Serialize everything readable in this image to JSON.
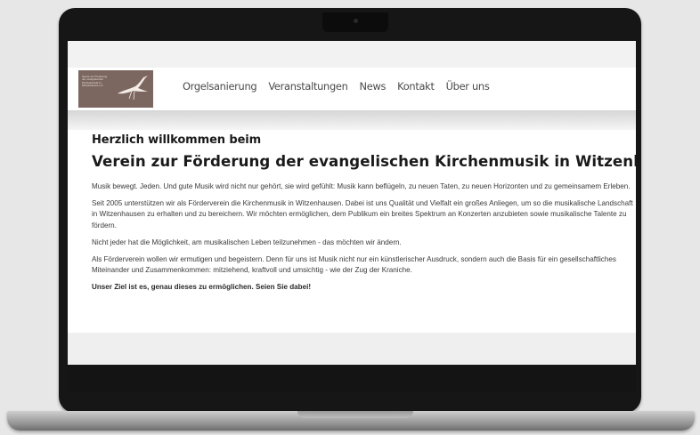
{
  "logo": {
    "text": "Verein zur Förderung\nder evangelischen\nKirchenmusik in\nWitzenhausen e.V."
  },
  "nav": {
    "items": [
      "Orgelsanierung",
      "Veranstaltungen",
      "News",
      "Kontakt",
      "Über uns"
    ]
  },
  "content": {
    "welcome": "Herzlich willkommen beim",
    "title": "Verein zur Förderung der evangelischen Kirchenmusik in Witzenhausen e.V.",
    "paragraphs": [
      "Musik bewegt. Jeden. Und gute Musik wird nicht nur gehört, sie wird gefühlt: Musik kann beflügeln, zu neuen Taten, zu neuen Horizonten und zu gemeinsamem Erleben.",
      "Seit 2005 unterstützen wir als Förderverein die Kirchenmusik in Witzenhausen. Dabei ist uns Qualität und Vielfalt ein großes Anliegen, um so die musikalische Landschaft in Witzenhausen zu erhalten und zu bereichern. Wir möchten ermöglichen, dem Publikum ein breites Spektrum an Konzerten anzubieten sowie musikalische Talente zu fördern.",
      "Nicht jeder hat die Möglichkeit, am musikalischen Leben teilzunehmen - das möchten wir ändern.",
      "Als Förderverein wollen wir ermutigen und begeistern. Denn für uns ist Musik nicht nur ein künstlerischer Ausdruck, sondern auch die Basis für ein gesellschaftliches Miteinander und Zusammenkommen: mitziehend, kraftvoll und umsichtig - wie der Zug der Kraniche."
    ],
    "closing": "Unser Ziel ist es, genau dieses zu ermöglichen. Seien Sie dabei!"
  },
  "colors": {
    "logo_bg": "#7b6760",
    "page_bg": "#e7e7e7",
    "laptop_frame": "#161616"
  }
}
